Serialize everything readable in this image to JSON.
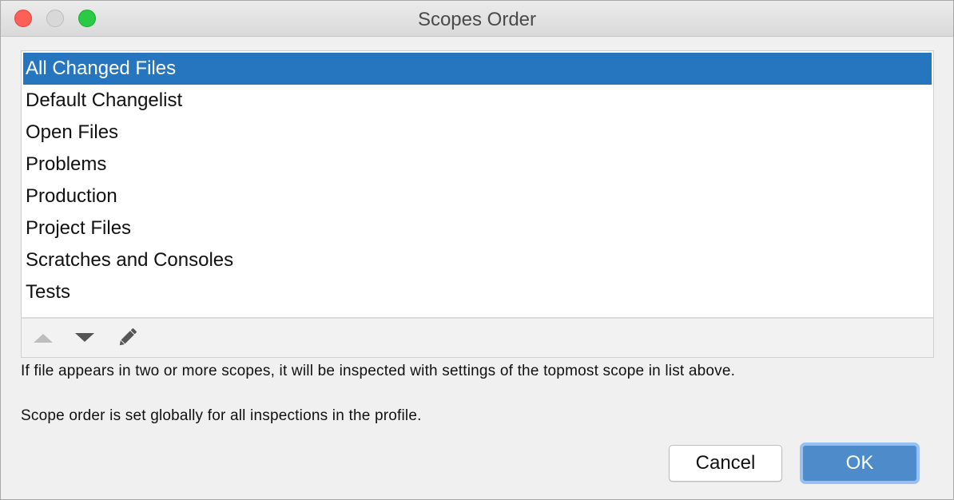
{
  "window": {
    "title": "Scopes Order"
  },
  "scopes": {
    "items": [
      {
        "label": "All Changed Files",
        "selected": true
      },
      {
        "label": "Default Changelist",
        "selected": false
      },
      {
        "label": "Open Files",
        "selected": false
      },
      {
        "label": "Problems",
        "selected": false
      },
      {
        "label": "Production",
        "selected": false
      },
      {
        "label": "Project Files",
        "selected": false
      },
      {
        "label": "Scratches and Consoles",
        "selected": false
      },
      {
        "label": "Tests",
        "selected": false
      }
    ]
  },
  "toolbar": {
    "move_up_icon": "triangle-up-icon",
    "move_down_icon": "triangle-down-icon",
    "edit_icon": "pencil-icon"
  },
  "description": {
    "line1": "If file appears in two or more scopes, it will be inspected with settings of the topmost scope in list above.",
    "line2": "Scope order is set globally for all inspections in the profile."
  },
  "buttons": {
    "cancel": "Cancel",
    "ok": "OK"
  },
  "colors": {
    "selection": "#2675bf",
    "ok_button": "#4d8bcb",
    "ok_focus_ring": "#97c1f2"
  }
}
